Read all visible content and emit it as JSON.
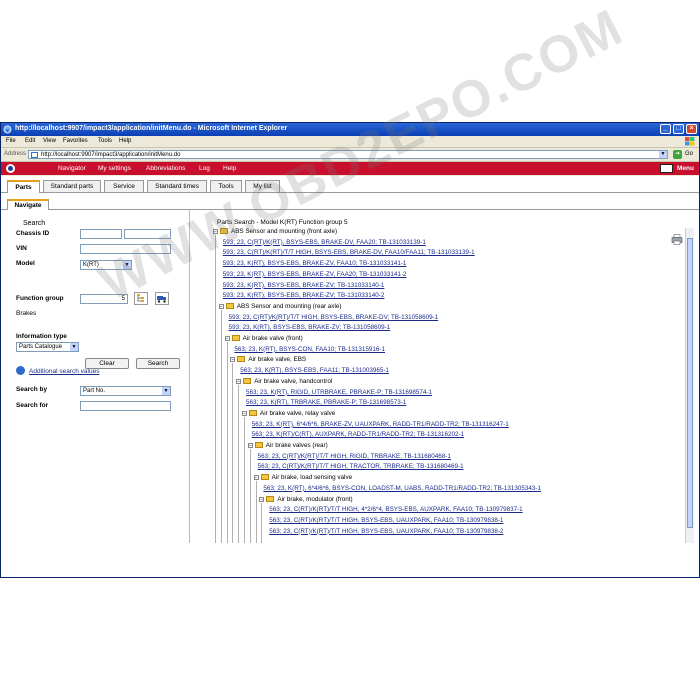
{
  "window": {
    "title": "http://localhost:9907/impact3/application/initMenu.do - Microsoft Internet Explorer"
  },
  "menubar": [
    "File",
    "Edit",
    "View",
    "Favorites",
    "Tools",
    "Help"
  ],
  "address": {
    "label": "Address",
    "url": "http://localhost:9907/impact3/application/initMenu.do",
    "go_label": "Go"
  },
  "appnav": {
    "items": [
      "Navigator",
      "My settings",
      "Abbreviations",
      "Log",
      "Help"
    ],
    "menu_label": "Menu"
  },
  "tabs": [
    "Parts",
    "Standard parts",
    "Service",
    "Standard times",
    "Tools",
    "My list"
  ],
  "active_tab": "Parts",
  "subtab": "Navigate",
  "search": {
    "title": "Search",
    "chassis_label": "Chassis ID",
    "vin_label": "VIN",
    "model_label": "Model",
    "model_value": "K(RT)",
    "function_group_label": "Function group",
    "function_group_value": "5",
    "function_group_name": "Brakes",
    "info_type_label": "Information type",
    "info_type_value": "Parts Catalogue",
    "clear_label": "Clear",
    "search_label": "Search",
    "additional_label": "Additional search values",
    "search_by_label": "Search by",
    "search_by_value": "Part No.",
    "search_for_label": "Search for"
  },
  "results": {
    "title": "Parts Search - Model K(RT) Function group 5",
    "nodes": [
      {
        "level": 0,
        "type": "folder",
        "text": "ABS Sensor and mounting (front axle)"
      },
      {
        "level": 1,
        "type": "link",
        "text": "593; 23, C(RT)/K(RT), BSYS-EBS, BRAKE-DV, FAA20; TB-131033139-1"
      },
      {
        "level": 1,
        "type": "link",
        "text": "593; 23, C(RT)/K(RT)/T/T HIGH, BSYS-EBS, BRAKE-DV, FAA10/FAA11; TB-131033139-1"
      },
      {
        "level": 1,
        "type": "link",
        "text": "593; 23, K(RT), BSYS-EBS, BRAKE-ZV, FAA10; TB-131033141-1"
      },
      {
        "level": 1,
        "type": "link",
        "text": "593; 23, K(RT), BSYS-EBS, BRAKE-ZV, FAA20; TB-131033141-2"
      },
      {
        "level": 1,
        "type": "link",
        "text": "593; 23, K(RT), BSYS-EBS, BRAKE-ZV; TB-131033140-1"
      },
      {
        "level": 1,
        "type": "link",
        "text": "593; 23, K(RT), BSYS-EBS, BRAKE-ZV; TB-131033140-2"
      },
      {
        "level": 1,
        "type": "folder",
        "text": "ABS Sensor and mounting (rear axle)"
      },
      {
        "level": 2,
        "type": "link",
        "text": "593; 23, C(RT)/K(RT)/T/T HIGH, BSYS-EBS, BRAKE-DV; TB-131058609-1"
      },
      {
        "level": 2,
        "type": "link",
        "text": "593; 23, K(RT), BSYS-EBS, BRAKE-ZV; TB-131058609-1"
      },
      {
        "level": 2,
        "type": "folder",
        "text": "Air brake valve (front)"
      },
      {
        "level": 3,
        "type": "link",
        "text": "563; 23, K(RT), BSYS-CON, FAA10; TB-131315916-1"
      },
      {
        "level": 3,
        "type": "folder",
        "text": "Air brake valve, EBS"
      },
      {
        "level": 4,
        "type": "link",
        "text": "563; 23, K(RT), BSYS-EBS, FAA11; TB-131003965-1"
      },
      {
        "level": 4,
        "type": "folder",
        "text": "Air brake valve, handcontrol"
      },
      {
        "level": 5,
        "type": "link",
        "text": "563; 23, K(RT), RIGID, UTRBRAKE, PBRAKE-P; TB-131698574-1"
      },
      {
        "level": 5,
        "type": "link",
        "text": "563; 23, K(RT), TRBRAKE, PBRAKE-P; TB-131698573-1"
      },
      {
        "level": 5,
        "type": "folder",
        "text": "Air brake valve, relay valve"
      },
      {
        "level": 6,
        "type": "link",
        "text": "563; 23, K(RT), 6*4/6*6, BRAKE-ZV, UAUXPARK, RADD-TR1/RADD-TR2; TB-131316247-1"
      },
      {
        "level": 6,
        "type": "link",
        "text": "563; 23, K(RT)/C(RT), AUXPARK, RADD-TR1/RADD-TR2; TB-131316202-1"
      },
      {
        "level": 6,
        "type": "folder",
        "text": "Air brake valves (rear)"
      },
      {
        "level": 7,
        "type": "link",
        "text": "563; 23, C(RT)/K(RT)/T/T HIGH, RIGID, TRBRAKE; TB-131680468-1"
      },
      {
        "level": 7,
        "type": "link",
        "text": "563; 23, C(RT)/K(RT)/T/T HIGH, TRACTOR, TRBRAKE; TB-131680469-1"
      },
      {
        "level": 7,
        "type": "folder",
        "text": "Air brake, load sensing valve"
      },
      {
        "level": 8,
        "type": "link",
        "text": "563; 23, K(RT), 6*4/6*6, BSYS-CON, LOADST-M, UABS, RADD-TR1/RADD-TR2; TB-131305343-1"
      },
      {
        "level": 8,
        "type": "folder",
        "text": "Air brake, modulator (front)"
      },
      {
        "level": 9,
        "type": "link",
        "text": "563; 23, C(RT)/K(RT)/T/T HIGH, 4*2/6*4, BSYS-EBS, AUXPARK, FAA10; TB-130979837-1"
      },
      {
        "level": 9,
        "type": "link",
        "text": "563; 23, C(RT)/K(RT)/T/T HIGH, BSYS-EBS, UAUXPARK, FAA10; TB-130979838-1"
      },
      {
        "level": 9,
        "type": "link",
        "text": "563; 23, C(RT)/K(RT)/T/T HIGH, BSYS-EBS, UAUXPARK, FAA10; TB-130979838-2"
      }
    ]
  },
  "watermark": "WWW.OBD2EPO.COM",
  "colors": {
    "title_bar": "#0b3fb5",
    "app_nav": "#c8102e",
    "link": "#1a2a8a",
    "folder": "#f3c740",
    "tab_accent": "#e5a020"
  }
}
